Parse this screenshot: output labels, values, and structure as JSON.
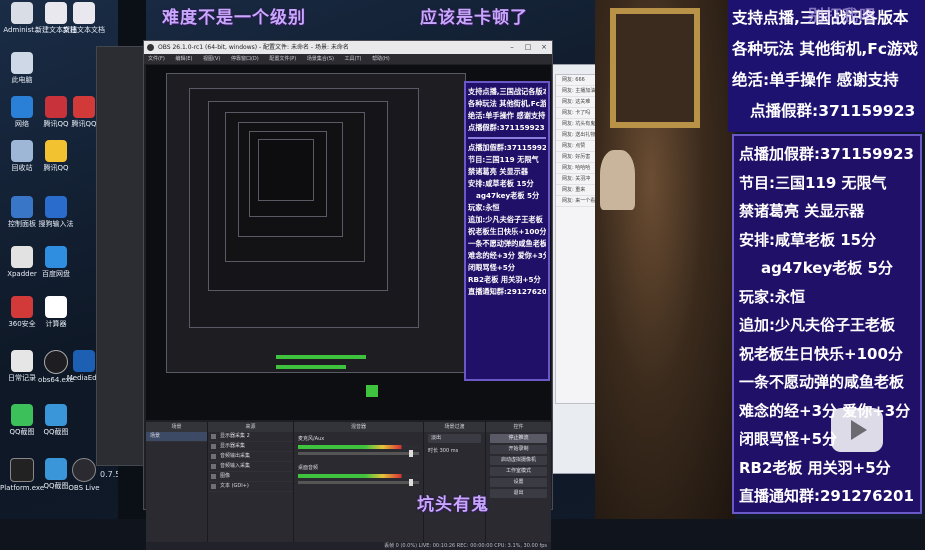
{
  "captions": {
    "top_left": "难度不是一个级别",
    "top_mid": "应该是卡顿了",
    "bottom": "坑头有鬼",
    "top_right": "别打我吧"
  },
  "obs": {
    "title": "OBS 26.1.0-rc1 (64-bit, windows) - 配置文件: 未命名 - 场景: 未命名",
    "menu": [
      "文件(F)",
      "编辑(E)",
      "视图(V)",
      "停靠窗口(D)",
      "配置文件(P)",
      "场景集合(S)",
      "工具(T)",
      "帮助(H)"
    ],
    "docks": {
      "scenes_header": "场景",
      "scene_item": "场景",
      "sources_header": "来源",
      "sources": [
        "显示器采集 2",
        "显示器采集",
        "音频输出采集",
        "音频输入采集",
        "图像",
        "文本 (GDI+)"
      ],
      "mixer_header": "混音器",
      "mixer_channels": [
        "麦克风/Aux",
        "桌面音频"
      ],
      "mixer_levels": [
        0.55,
        0.4
      ],
      "transition_header": "场景过渡",
      "transition_value": "淡出",
      "duration_label": "时长",
      "duration_value": "300 ms",
      "controls_header": "控件",
      "controls": [
        "停止推流",
        "开始录制",
        "启动虚拟摄像机",
        "工作室模式",
        "设置",
        "退出"
      ]
    },
    "status": "丢帧 0 (0.0%)  LIVE: 00:10:26  REC: 00:00:00  CPU: 3.1%, 30.00 fps"
  },
  "inner_panel": {
    "lines": [
      "支持点播,三国战记各版本",
      "各种玩法 其他街机,Fc游戏",
      "绝活:单手操作 感谢支持",
      "点播假群:371159923",
      "点播加假群:371159923",
      "节目:三国119 无限气",
      "禁诸葛亮 关显示器",
      "安排:咸草老板 15分",
      "ag47key老板 5分",
      "玩家:永恒",
      "追加:少凡夫俗子王老板",
      "祝老板生日快乐+100分",
      "一条不愿动弹的咸鱼老板",
      "难念的经+3分 爱你+3分",
      "闭眼骂怪+5分",
      "RB2老板 用关羽+5分",
      "直播通知群:291276201"
    ]
  },
  "right_panel": {
    "header_lines": [
      "支持点播,三国战记各版本",
      "各种玩法 其他街机,Fc游戏",
      "绝活:单手操作 感谢支持",
      "点播假群:371159923"
    ],
    "lines": [
      "点播加假群:371159923",
      "节目:三国119 无限气",
      "禁诸葛亮 关显示器",
      "安排:咸草老板 15分",
      "ag47key老板 5分",
      "玩家:永恒",
      "追加:少凡夫俗子王老板",
      "祝老板生日快乐+100分",
      "一条不愿动弹的咸鱼老板",
      "难念的经+3分 爱你+3分",
      "闭眼骂怪+5分",
      "RB2老板 用关羽+5分",
      "直播通知群:291276201"
    ]
  },
  "desktop": {
    "icons": [
      "Administ...",
      "此电脑",
      "新建文本文档",
      "网络",
      "回收站",
      "腾讯QQ",
      "控制面板",
      "搜狗输入法",
      "百度网盘",
      "Xpadder",
      "360安全",
      "计算器",
      "日常记录",
      "obs64.exe",
      "MediaEdit",
      "QQ截图",
      "Platform.exe",
      "OBS Live"
    ],
    "clock": "0.7.52"
  },
  "chat": {
    "lines": [
      "网友: 666",
      "网友: 主播加油",
      "网友: 这关难",
      "网友: 卡了吗",
      "网友: 坑头有鬼",
      "网友: 送出礼物",
      "网友: 点赞",
      "网友: 好厉害",
      "网友: 哈哈哈",
      "网友: 关羽冲",
      "网友: 重来",
      "网友: 来一个看看"
    ]
  },
  "colors": {
    "panel_bg": "#201068",
    "panel_border": "#6a58c8",
    "caption": "#c9a7ff",
    "obs_bg": "#1f1f23"
  }
}
